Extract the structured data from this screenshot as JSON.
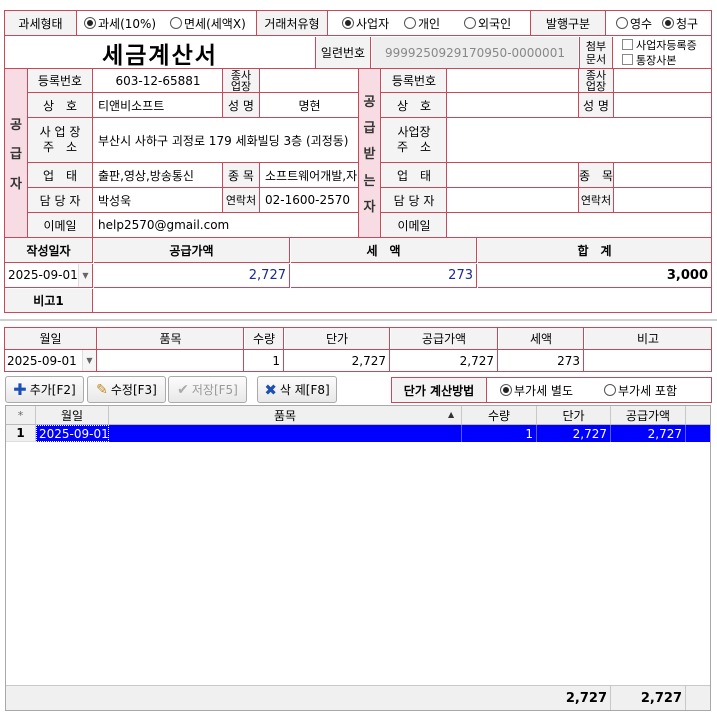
{
  "top": {
    "tax_type_label": "과세형태",
    "tax_opt1": "과세(10%)",
    "tax_opt2": "면세(세액X)",
    "partner_type_label": "거래처유형",
    "partner_opt1": "사업자",
    "partner_opt2": "개인",
    "partner_opt3": "외국인",
    "issue_label": "발행구분",
    "issue_opt1": "영수",
    "issue_opt2": "청구"
  },
  "title": {
    "doc_title": "세금계산서",
    "serial_label": "일련번호",
    "serial_value": "9999250929170950-0000001",
    "attach_label": "첨부\n문서",
    "attach_opt1": "사업자등록증",
    "attach_opt2": "통장사본"
  },
  "supplier": {
    "section": [
      "공",
      "급",
      "자"
    ],
    "reg_label": "등록번호",
    "reg_value": "603-12-65881",
    "sub_label": "종사\n업장",
    "sub_value": "",
    "name_label": "상　호",
    "name_value": "티앤비소프트",
    "rep_label": "성 명",
    "rep_value": "명현",
    "addr_label": "사 업 장\n주　소",
    "addr_value": "부산시 사하구 괴정로 179 세화빌딩 3층 (괴정동)",
    "biz_label": "업　태",
    "biz_value": "출판,영상,방송통신",
    "item_label": "종 목",
    "item_value": "소프트웨어개발,자",
    "mgr_label": "담 당 자",
    "mgr_value": "박성욱",
    "tel_label": "연락처",
    "tel_value": "02-1600-2570",
    "email_label": "이메일",
    "email_value": "help2570@gmail.com"
  },
  "buyer": {
    "section": [
      "공",
      "급",
      "받",
      "는",
      "자"
    ],
    "reg_label": "등록번호",
    "reg_value": "",
    "sub_label": "종사\n업장",
    "sub_value": "",
    "name_label": "상　호",
    "name_value": "",
    "rep_label": "성 명",
    "rep_value": "",
    "addr_label": "사업장\n주　소",
    "addr_value": "",
    "biz_label": "업　태",
    "biz_value": "",
    "item_label": "종　목",
    "item_value": "",
    "mgr_label": "담 당 자",
    "mgr_value": "",
    "tel_label": "연락처",
    "tel_value": "",
    "email_label": "이메일",
    "email_value": ""
  },
  "summary": {
    "date_label": "작성일자",
    "supply_label": "공급가액",
    "tax_label": "세　액",
    "total_label": "합　계",
    "date_value": "2025-09-01",
    "supply_value": "2,727",
    "tax_value": "273",
    "total_value": "3,000",
    "note_label": "비고1",
    "note_value": ""
  },
  "entry": {
    "headers": [
      "월일",
      "품목",
      "수량",
      "단가",
      "공급가액",
      "세액",
      "비고"
    ],
    "date": "2025-09-01",
    "item": "",
    "qty": "1",
    "price": "2,727",
    "supply": "2,727",
    "tax": "273",
    "note": ""
  },
  "toolbar": {
    "add": "추가[F2]",
    "edit": "수정[F3]",
    "save": "저장[F5]",
    "delete": "삭 제[F8]",
    "calc_label": "단가 계산방법",
    "calc_opt1": "부가세 별도",
    "calc_opt2": "부가세 포함"
  },
  "grid": {
    "corner": "*",
    "headers": [
      "월일",
      "품목",
      "수량",
      "단가",
      "공급가액"
    ],
    "rows": [
      {
        "no": "1",
        "date": "2025-09-01",
        "item": "",
        "qty": "1",
        "price": "2,727",
        "supply": "2,727"
      }
    ],
    "footer_price": "2,727",
    "footer_supply": "2,727"
  },
  "colors": {
    "border": "#c84a5a",
    "section_bg": "#f7dde3",
    "selection": "#0000ff"
  }
}
